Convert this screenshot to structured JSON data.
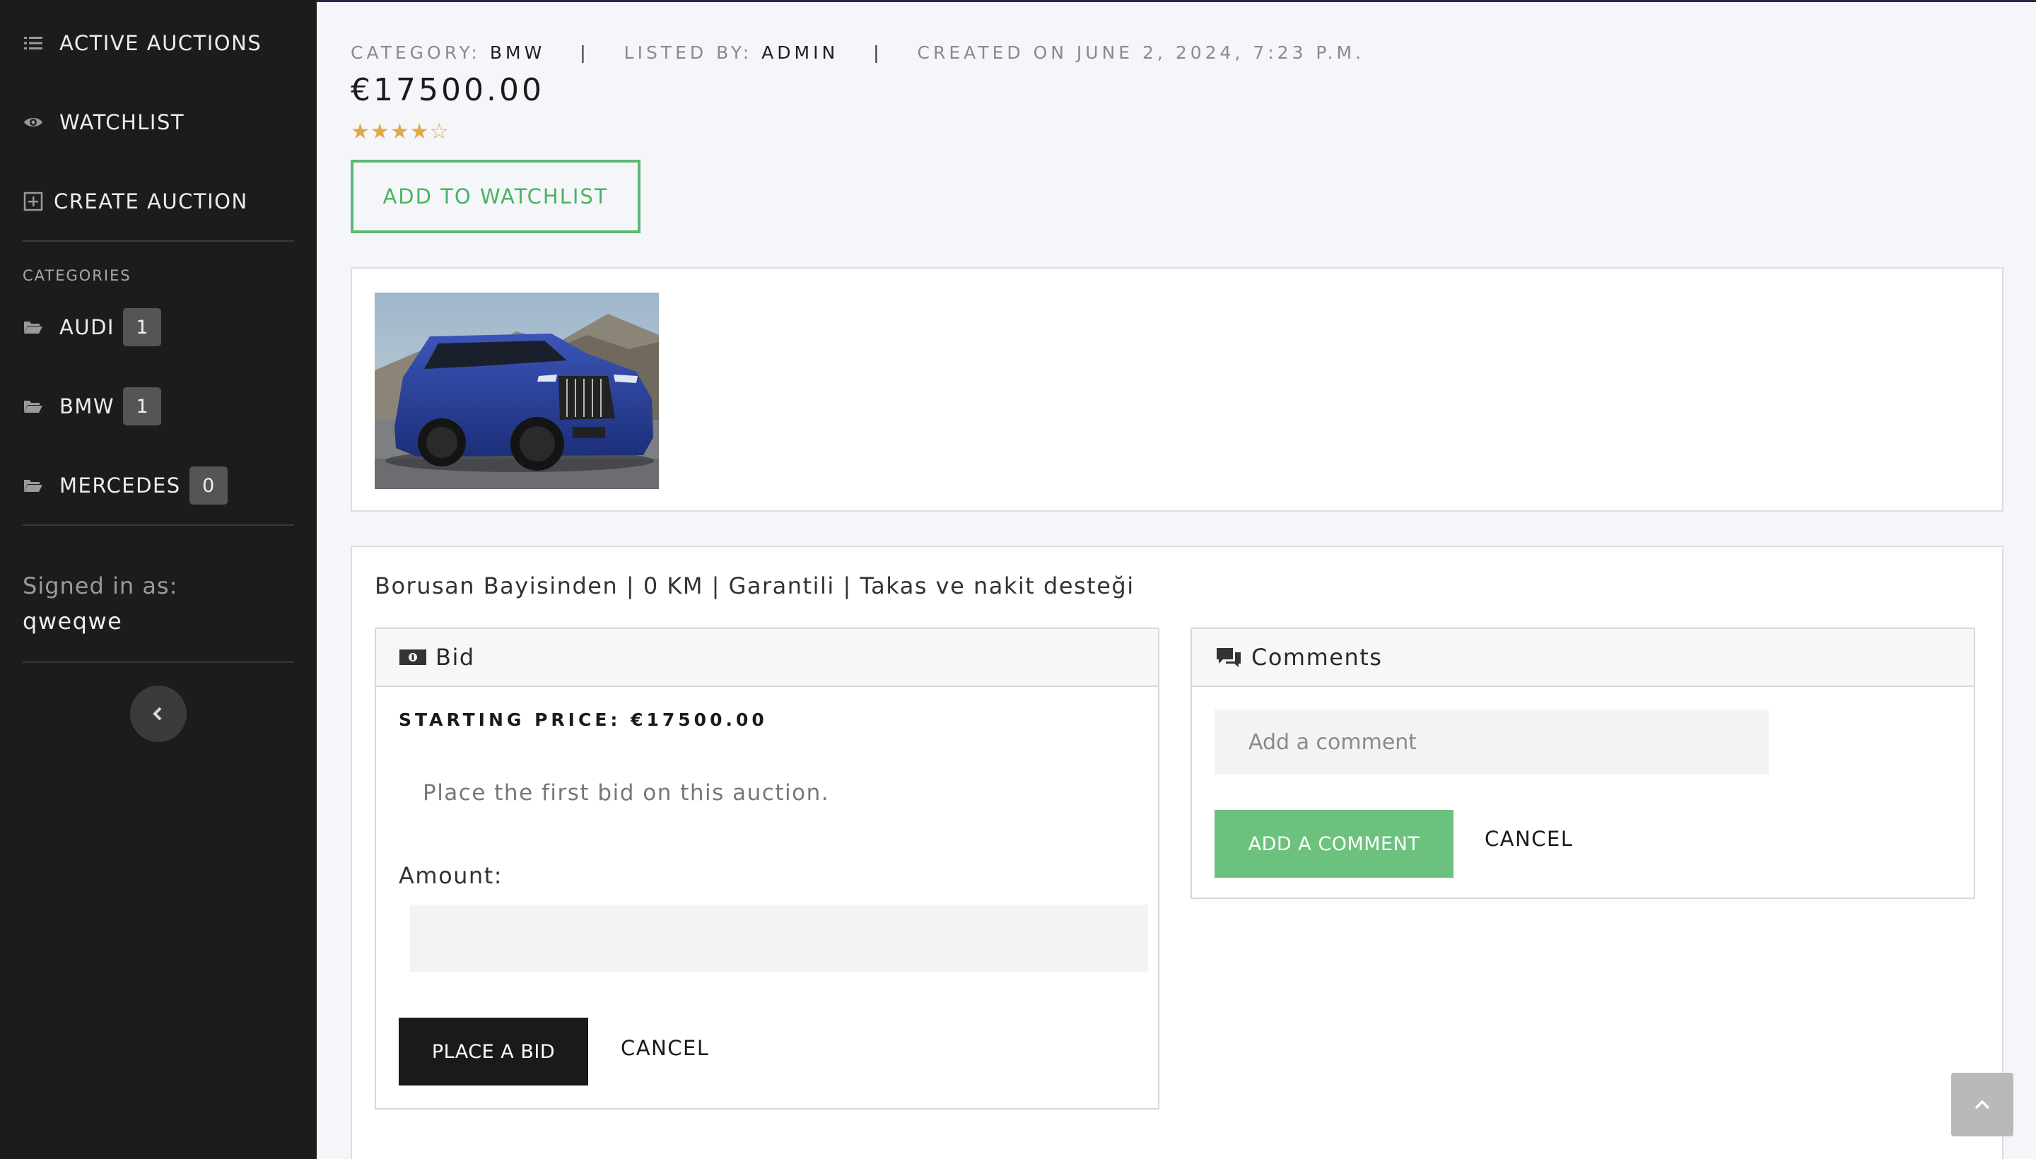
{
  "sidebar": {
    "nav": [
      {
        "label": "ACTIVE AUCTIONS",
        "icon": "list-icon"
      },
      {
        "label": "WATCHLIST",
        "icon": "eye-icon"
      },
      {
        "label": "CREATE AUCTION",
        "icon": "plus-square-icon"
      }
    ],
    "categories_heading": "CATEGORIES",
    "categories": [
      {
        "label": "AUDI",
        "count": "1"
      },
      {
        "label": "BMW",
        "count": "1"
      },
      {
        "label": "MERCEDES",
        "count": "0"
      }
    ],
    "signed_in_label": "Signed in as:",
    "username": "qweqwe"
  },
  "listing": {
    "category_label": "CATEGORY:",
    "category_value": "BMW",
    "listed_by_label": "LISTED BY:",
    "listed_by_value": "ADMIN",
    "separator": "|",
    "created_on": "CREATED ON JUNE 2, 2024, 7:23 P.M.",
    "price": "€17500.00",
    "rating": 4,
    "rating_max": 5,
    "watchlist_button": "ADD TO WATCHLIST",
    "description": "Borusan Bayisinden | 0 KM | Garantili | Takas ve nakit desteği"
  },
  "bid": {
    "title": "Bid",
    "starting_price": "STARTING PRICE: €17500.00",
    "first_bid_text": "Place the first bid on this auction.",
    "amount_label": "Amount:",
    "amount_value": "",
    "place_button": "PLACE A BID",
    "cancel_button": "CANCEL"
  },
  "comments": {
    "title": "Comments",
    "input_placeholder": "Add a comment",
    "add_button": "ADD A COMMENT",
    "cancel_button": "CANCEL"
  },
  "colors": {
    "sidebar_bg": "#1c1c1c",
    "accent_green": "#5cb874",
    "star_color": "#e0a94a"
  }
}
